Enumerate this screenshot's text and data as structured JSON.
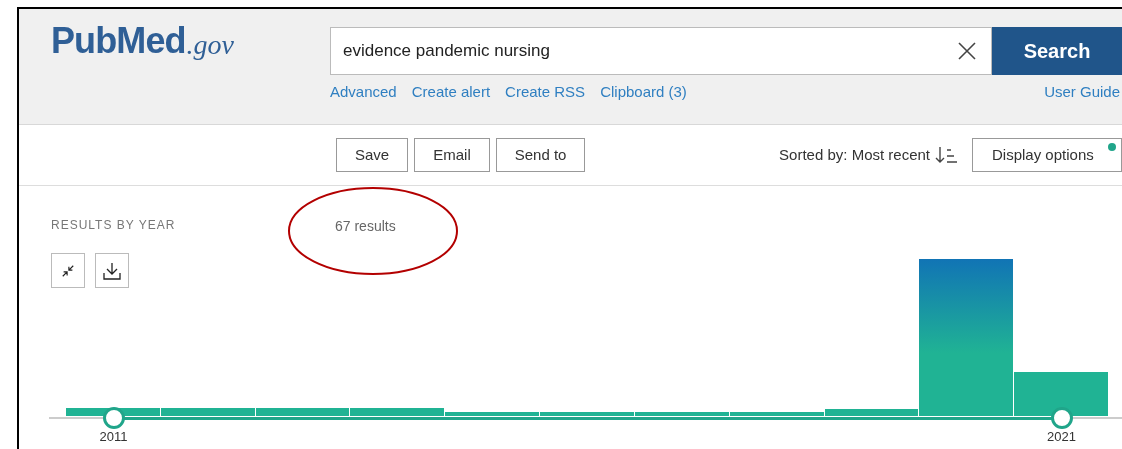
{
  "header": {
    "logo": {
      "brand": "PubMed",
      "suffix": ".gov"
    },
    "search": {
      "value": "evidence pandemic nursing",
      "button": "Search"
    },
    "links": [
      "Advanced",
      "Create alert",
      "Create RSS",
      "Clipboard (3)"
    ],
    "user_guide": "User Guide"
  },
  "toolbar": {
    "actions": [
      "Save",
      "Email",
      "Send to"
    ],
    "sort": "Sorted by: Most recent",
    "display_options": {
      "label": "Display options",
      "indicator": true
    }
  },
  "results_by_year": {
    "heading": "RESULTS BY YEAR",
    "count": "67 results",
    "range_handles": [
      {
        "label": "2011",
        "level": 0.06
      },
      {
        "label": "2021",
        "level": 0.941
      }
    ]
  }
}
